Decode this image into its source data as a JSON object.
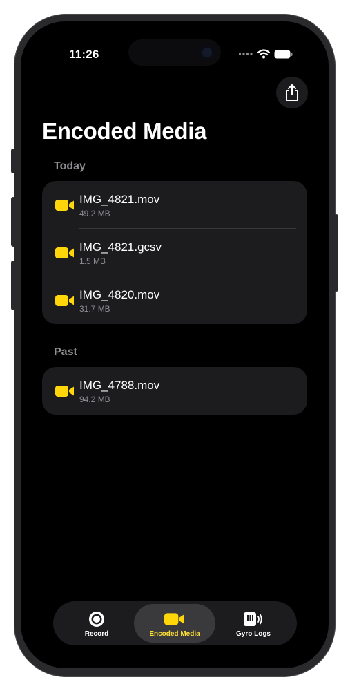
{
  "status_bar": {
    "time": "11:26"
  },
  "header": {
    "title": "Encoded Media",
    "share_icon": "share-icon"
  },
  "sections": [
    {
      "title": "Today",
      "items": [
        {
          "name": "IMG_4821.mov",
          "size": "49.2 MB",
          "icon": "video-camera-icon"
        },
        {
          "name": "IMG_4821.gcsv",
          "size": "1.5 MB",
          "icon": "video-camera-icon"
        },
        {
          "name": "IMG_4820.mov",
          "size": "31.7 MB",
          "icon": "video-camera-icon"
        }
      ]
    },
    {
      "title": "Past",
      "items": [
        {
          "name": "IMG_4788.mov",
          "size": "94.2 MB",
          "icon": "video-camera-icon"
        }
      ]
    }
  ],
  "tabbar": {
    "selected": "Encoded Media",
    "tabs": [
      {
        "label": "Record",
        "icon": "record-icon"
      },
      {
        "label": "Encoded Media",
        "icon": "video-camera-icon"
      },
      {
        "label": "Gyro Logs",
        "icon": "gyro-logs-icon"
      }
    ]
  },
  "colors": {
    "accent": "#FFD60A",
    "background": "#000000",
    "card": "#1C1C1E",
    "secondary_text": "#8E8E93"
  }
}
